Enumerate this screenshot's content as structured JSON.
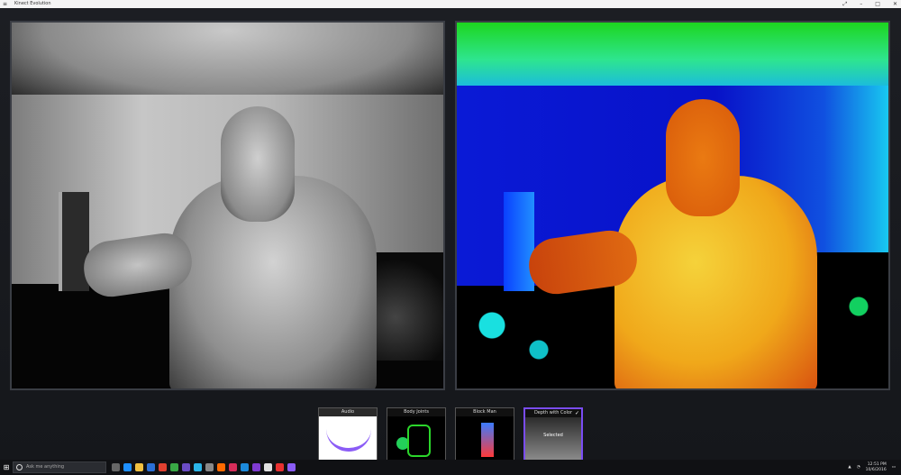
{
  "window": {
    "title": "Kinect Evolution",
    "menu_icon": "hamburger-icon"
  },
  "views": {
    "left": "ir-depth-view",
    "right": "depth-color-view"
  },
  "gallery": [
    {
      "label": "Audio",
      "selected": false
    },
    {
      "label": "Body Joints",
      "selected": false
    },
    {
      "label": "Block Man",
      "selected": false
    },
    {
      "label": "Depth with Color",
      "selected": true,
      "status": "Selected"
    }
  ],
  "taskbar": {
    "search_placeholder": "Ask me anything",
    "clock_time": "12:51 PM",
    "clock_date": "10/6/2016"
  },
  "colors": {
    "accent": "#7a4cf5",
    "panel_border": "#3a3d44",
    "background": "#1b1d22"
  }
}
